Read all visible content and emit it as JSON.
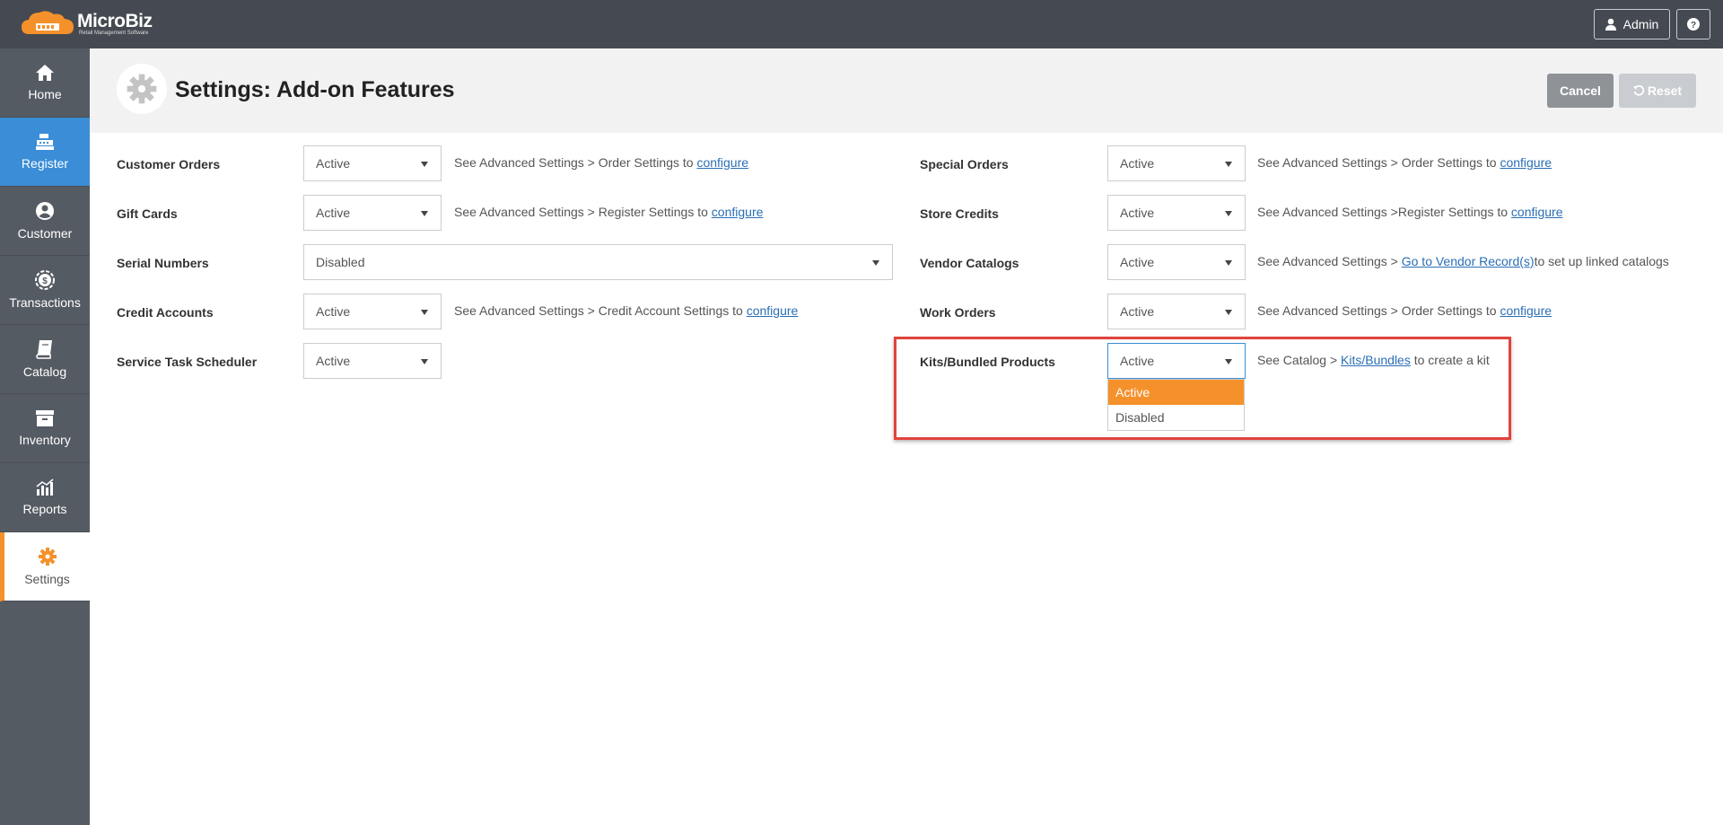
{
  "app": {
    "logo_name": "MicroBiz",
    "logo_tagline": "Retail Management Software",
    "user_label": "Admin",
    "help_icon": "question-circle-icon"
  },
  "sidebar": {
    "items": [
      {
        "label": "Home",
        "icon": "home-icon"
      },
      {
        "label": "Register",
        "icon": "cash-register-icon"
      },
      {
        "label": "Customer",
        "icon": "user-circle-icon"
      },
      {
        "label": "Transactions",
        "icon": "coin-icon"
      },
      {
        "label": "Catalog",
        "icon": "book-icon"
      },
      {
        "label": "Inventory",
        "icon": "box-icon"
      },
      {
        "label": "Reports",
        "icon": "bar-chart-icon"
      },
      {
        "label": "Settings",
        "icon": "gear-icon"
      }
    ]
  },
  "header": {
    "title": "Settings: Add-on Features",
    "cancel_label": "Cancel",
    "reset_label": "Reset"
  },
  "left_rows": [
    {
      "label": "Customer Orders",
      "value": "Active",
      "note_prefix": "See Advanced Settings > Order Settings to ",
      "link": "configure",
      "note_suffix": ""
    },
    {
      "label": "Gift Cards",
      "value": "Active",
      "note_prefix": "See Advanced Settings > Register Settings to ",
      "link": "configure",
      "note_suffix": ""
    },
    {
      "label": "Serial Numbers",
      "value": "Disabled",
      "note_prefix": "",
      "link": "",
      "note_suffix": ""
    },
    {
      "label": "Credit Accounts",
      "value": "Active",
      "note_prefix": "See Advanced Settings > Credit Account Settings to ",
      "link": "configure",
      "note_suffix": ""
    },
    {
      "label": "Service Task Scheduler",
      "value": "Active",
      "note_prefix": "",
      "link": "",
      "note_suffix": ""
    }
  ],
  "right_rows": [
    {
      "label": "Special Orders",
      "value": "Active",
      "note_prefix": "See Advanced Settings > Order Settings to ",
      "link": "configure",
      "note_suffix": ""
    },
    {
      "label": "Store Credits",
      "value": "Active",
      "note_prefix": "See Advanced Settings >Register Settings to ",
      "link": "configure",
      "note_suffix": ""
    },
    {
      "label": "Vendor Catalogs",
      "value": "Active",
      "note_prefix": "See Advanced Settings > ",
      "link": "Go to Vendor Record(s)",
      "note_suffix": "to set up linked catalogs"
    },
    {
      "label": "Work Orders",
      "value": "Active",
      "note_prefix": "See Advanced Settings > Order Settings to ",
      "link": "configure",
      "note_suffix": ""
    },
    {
      "label": "Kits/Bundled Products",
      "value": "Active",
      "note_prefix": "See Catalog > ",
      "link": "Kits/Bundles",
      "note_suffix": " to create a kit"
    }
  ],
  "dropdown_options": [
    "Active",
    "Disabled"
  ],
  "colors": {
    "accent_orange": "#f5912b",
    "accent_blue": "#3a8dd6",
    "highlight_red": "#e0443d"
  }
}
